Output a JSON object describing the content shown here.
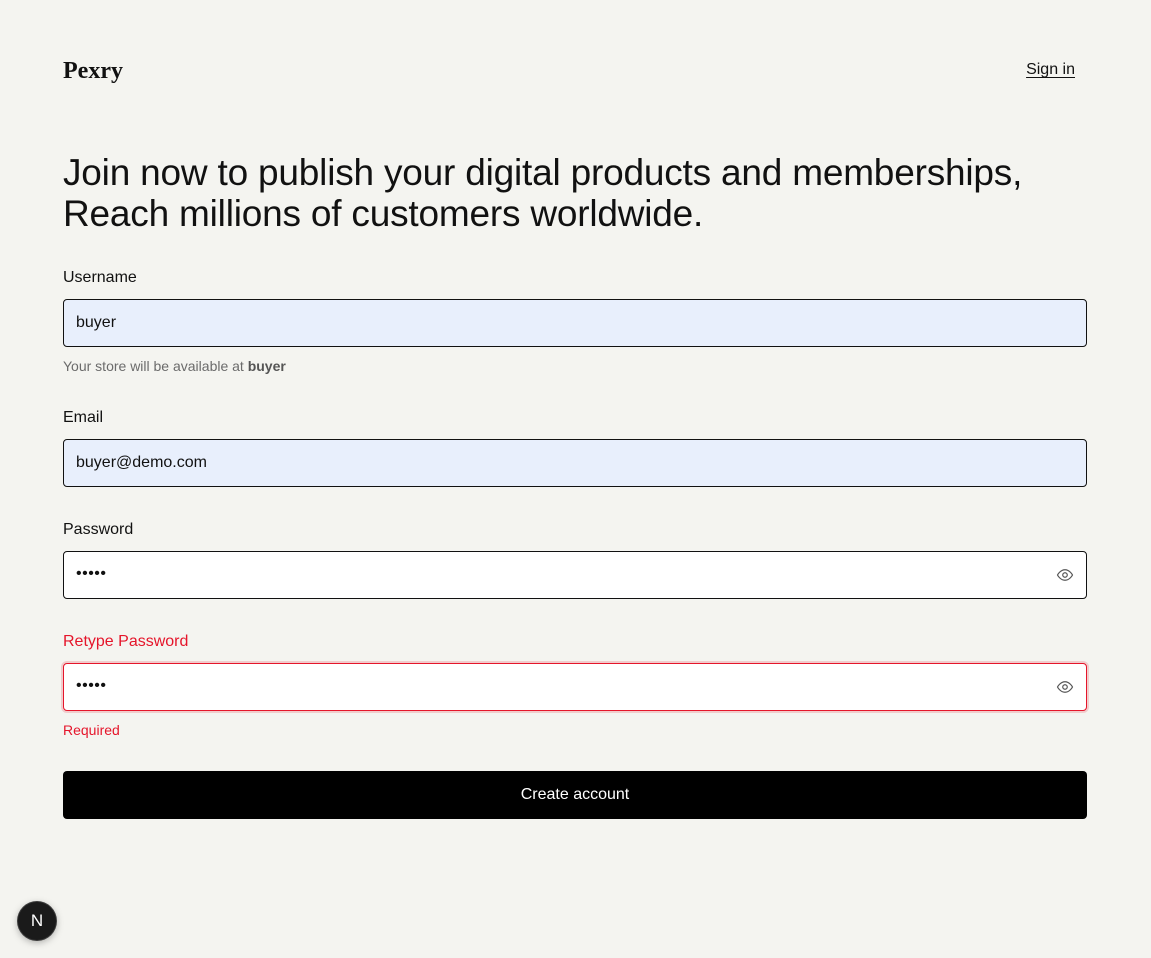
{
  "header": {
    "logo": "Pexry",
    "signin_label": "Sign in"
  },
  "headline": {
    "line1": "Join now to publish your digital products and memberships,",
    "line2": "Reach millions of customers worldwide."
  },
  "form": {
    "username": {
      "label": "Username",
      "value": "buyer",
      "helper_prefix": "Your store will be available at ",
      "helper_value": "buyer"
    },
    "email": {
      "label": "Email",
      "value": "buyer@demo.com"
    },
    "password": {
      "label": "Password",
      "masked_value": "•••••",
      "toggle_icon": "eye-icon"
    },
    "retype_password": {
      "label": "Retype Password",
      "masked_value": "•••••",
      "toggle_icon": "eye-icon",
      "error": "Required"
    },
    "submit_label": "Create account"
  },
  "dev_indicator": {
    "letter": "N"
  },
  "colors": {
    "background": "#f4f4f0",
    "autofill": "#e8effc",
    "error": "#e5152b",
    "button": "#000000"
  }
}
